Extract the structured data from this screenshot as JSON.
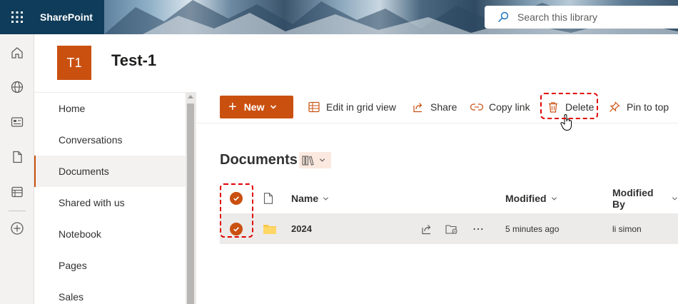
{
  "suite": {
    "app_name": "SharePoint",
    "search_placeholder": "Search this library",
    "icons": [
      "waffle-icon",
      "search-icon"
    ]
  },
  "appbar": {
    "items": [
      "home-icon",
      "globe-icon",
      "news-icon",
      "file-icon",
      "lists-icon",
      "create-icon"
    ]
  },
  "site": {
    "logo_text": "T1",
    "logo_color": "#ca5010",
    "title": "Test-1"
  },
  "leftnav": {
    "items": [
      {
        "label": "Home",
        "active": false
      },
      {
        "label": "Conversations",
        "active": false
      },
      {
        "label": "Documents",
        "active": true
      },
      {
        "label": "Shared with us",
        "active": false
      },
      {
        "label": "Notebook",
        "active": false
      },
      {
        "label": "Pages",
        "active": false
      },
      {
        "label": "Sales",
        "active": false
      }
    ]
  },
  "commandbar": {
    "new_label": "New",
    "edit_grid_label": "Edit in grid view",
    "share_label": "Share",
    "copy_link_label": "Copy link",
    "delete_label": "Delete",
    "pin_label": "Pin to top"
  },
  "library": {
    "title": "Documents",
    "columns": {
      "name": "Name",
      "modified": "Modified",
      "modified_by": "Modified By"
    },
    "rows": [
      {
        "name": "2024",
        "modified": "5 minutes ago",
        "modified_by": "li simon",
        "type": "folder",
        "selected": true
      }
    ]
  },
  "colors": {
    "accent": "#ca5010",
    "highlight": "#e00000",
    "suitebar_dark": "#0f3c5a"
  }
}
